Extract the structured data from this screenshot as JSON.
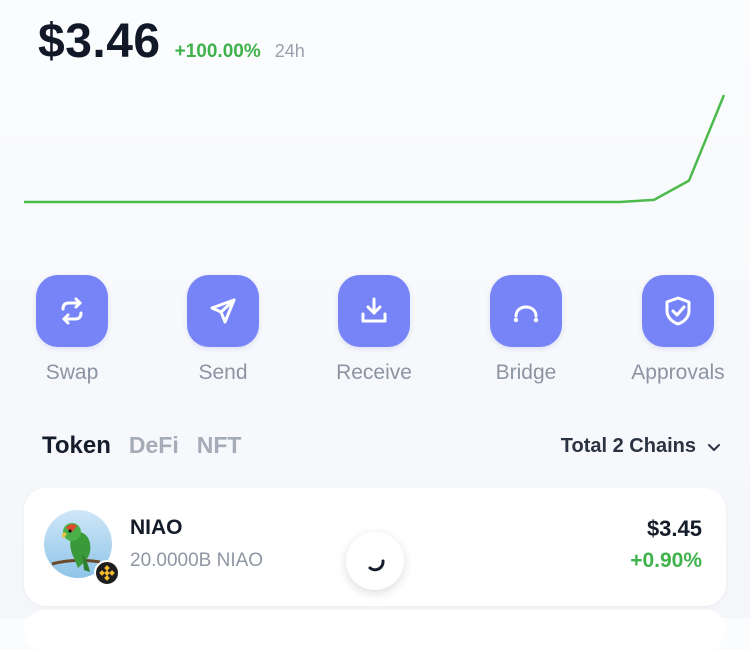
{
  "balance": {
    "value": "$3.46",
    "change": "+100.00%",
    "period": "24h"
  },
  "price_chart": {
    "series": [
      0,
      0,
      0,
      0,
      0,
      0,
      0,
      0,
      0,
      0,
      0,
      0,
      0,
      0,
      0,
      0,
      0,
      0,
      0.02,
      0.2,
      1
    ],
    "color": "#4cbb4c"
  },
  "actions": [
    {
      "label": "Swap",
      "icon": "swap-icon"
    },
    {
      "label": "Send",
      "icon": "send-icon"
    },
    {
      "label": "Receive",
      "icon": "receive-icon"
    },
    {
      "label": "Bridge",
      "icon": "bridge-icon"
    },
    {
      "label": "Approvals",
      "icon": "shield-check-icon"
    }
  ],
  "tabs": [
    {
      "label": "Token",
      "active": true
    },
    {
      "label": "DeFi",
      "active": false
    },
    {
      "label": "NFT",
      "active": false
    }
  ],
  "chains_filter": {
    "label": "Total 2 Chains",
    "icon": "chevron-down-icon"
  },
  "tokens": [
    {
      "name": "NIAO",
      "amount": "20.0000B NIAO",
      "value": "$3.45",
      "change": "+0.90%",
      "icon": "parrot-icon",
      "chain_badge": "bnb-chain-icon"
    }
  ],
  "colors": {
    "accent": "#7684f7",
    "positive": "#3fb24c",
    "muted": "#8c94a2"
  }
}
